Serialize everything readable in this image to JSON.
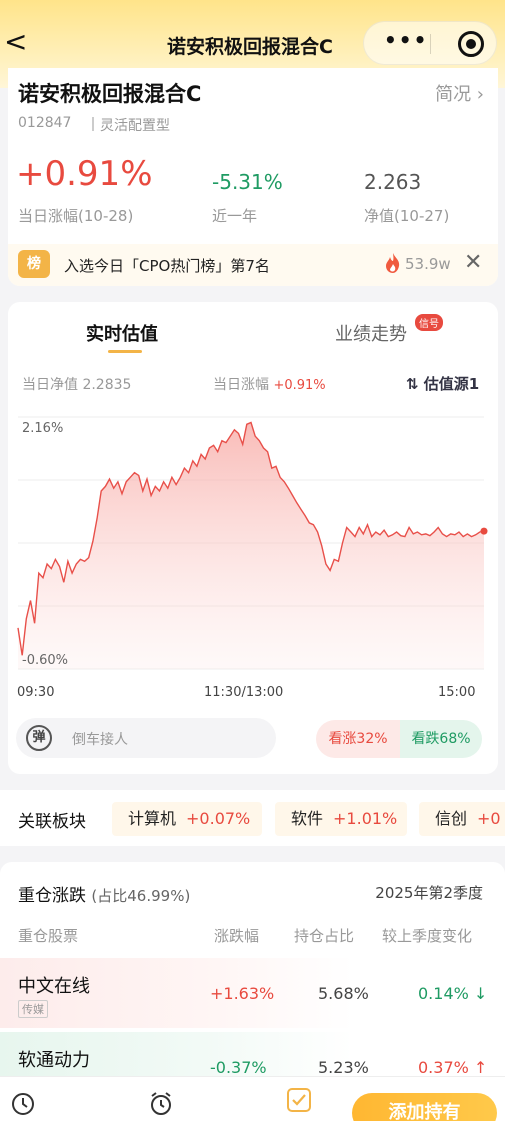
{
  "nav": {
    "title": "诺安积极回报混合C",
    "back_glyph": "<",
    "more_glyph": "•••"
  },
  "fund": {
    "name": "诺安积极回报混合C",
    "summary_link": "简况 ›",
    "code": "012847",
    "type": "灵活配置型",
    "daily_change": "+0.91%",
    "daily_change_label": "当日涨幅(10-28)",
    "year_change": "-5.31%",
    "year_label": "近一年",
    "nav_value": "2.263",
    "nav_label": "净值(10-27)"
  },
  "rank": {
    "badge": "榜",
    "text": "入选今日「CPO热门榜」第7名",
    "heat": "53.9w",
    "close_glyph": "✕"
  },
  "estimate": {
    "tab_realtime": "实时估值",
    "tab_trend": "业绩走势",
    "tab_trend_badge": "信号",
    "nav_label": "当日净值 2.2835",
    "change_label": "当日涨幅",
    "change_value": "+0.91%",
    "source": "⇅ 估值源1",
    "danmu_icon": "弹",
    "input_placeholder": "倒车接人",
    "bullish": "看涨32%",
    "bearish": "看跌68%"
  },
  "chart_data": {
    "type": "area",
    "x_labels": [
      "09:30",
      "11:30/13:00",
      "15:00"
    ],
    "y_labels": [
      "2.16%",
      "-0.60%"
    ],
    "ylim": [
      -0.6,
      2.16
    ],
    "grid": true,
    "series": [
      {
        "values": [
          -0.15,
          -0.45,
          -0.05,
          0.15,
          -0.1,
          0.45,
          0.4,
          0.55,
          0.5,
          0.6,
          0.52,
          0.35,
          0.58,
          0.45,
          0.55,
          0.6,
          0.58,
          0.62,
          0.8,
          1.05,
          1.35,
          1.4,
          1.48,
          1.38,
          1.45,
          1.32,
          1.45,
          1.5,
          1.55,
          1.52,
          1.35,
          1.48,
          1.3,
          1.4,
          1.35,
          1.45,
          1.38,
          1.5,
          1.42,
          1.5,
          1.6,
          1.55,
          1.68,
          1.62,
          1.75,
          1.7,
          1.82,
          1.85,
          1.78,
          1.9,
          1.88,
          1.95,
          2.02,
          1.98,
          1.86,
          2.08,
          2.1,
          1.95,
          1.9,
          1.82,
          1.78,
          1.6,
          1.62,
          1.5,
          1.45,
          1.38,
          1.3,
          1.22,
          1.15,
          1.08,
          1.0,
          0.98,
          0.9,
          0.75,
          0.55,
          0.48,
          0.6,
          0.58,
          0.78,
          0.95,
          0.9,
          0.85,
          0.95,
          0.88,
          0.98,
          0.85,
          0.9,
          0.87,
          0.92,
          0.85,
          0.87,
          0.9,
          0.86,
          0.85,
          0.95,
          0.88,
          0.9,
          0.87,
          0.88,
          0.86,
          0.9,
          0.95,
          0.88,
          0.85,
          0.88,
          0.87,
          0.9,
          0.85,
          0.88,
          0.85,
          0.87,
          0.9,
          0.91
        ]
      }
    ]
  },
  "sectors": {
    "title": "关联板块",
    "items": [
      {
        "name": "计算机",
        "change": "+0.07%"
      },
      {
        "name": "软件",
        "change": "+1.01%"
      },
      {
        "name": "信创",
        "change": "+0"
      }
    ]
  },
  "holdings": {
    "title": "重仓涨跌",
    "ratio": "(占比46.99%)",
    "quarter": "2025年第2季度",
    "headers": [
      "重仓股票",
      "涨跌幅",
      "持仓占比",
      "较上季度变化"
    ],
    "rows": [
      {
        "name": "中文在线",
        "tag": "传媒",
        "change": "+1.63%",
        "hold": "5.68%",
        "qchange": "0.14%",
        "arrow": "↓"
      },
      {
        "name": "软通动力",
        "tag": "",
        "change": "-0.37%",
        "hold": "5.23%",
        "qchange": "0.37%",
        "arrow": "↑"
      }
    ]
  },
  "bottom": {
    "add_button": "添加持有"
  },
  "colors": {
    "up": "#e84a3f",
    "down": "#1f9b63",
    "accent": "#f3b447"
  }
}
